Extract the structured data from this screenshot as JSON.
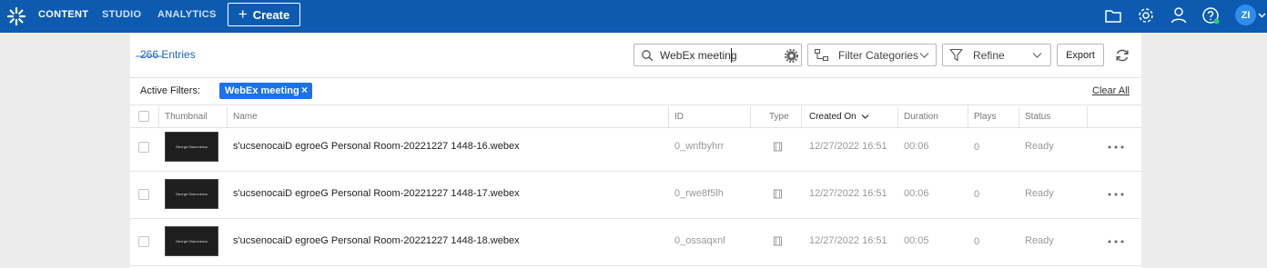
{
  "nav": {
    "items": [
      "CONTENT",
      "STUDIO",
      "ANALYTICS"
    ],
    "create_label": "Create",
    "avatar_initials": "ZI"
  },
  "toolbar": {
    "entries_count": "266 Entries",
    "search_value": "WebEx meeting",
    "filter_categories_label": "Filter Categories",
    "refine_label": "Refine",
    "export_label": "Export"
  },
  "filters": {
    "active_label": "Active Filters:",
    "chips": [
      "WebEx meeting"
    ],
    "clear_all_label": "Clear All"
  },
  "table": {
    "headers": {
      "thumbnail": "Thumbnail",
      "name": "Name",
      "id": "ID",
      "type": "Type",
      "created_on": "Created On",
      "duration": "Duration",
      "plays": "Plays",
      "status": "Status"
    },
    "rows": [
      {
        "thumb_text": "George Diaconescu",
        "name": "George Diaconescu's Personal Room-20221227 1448-16.webex",
        "name_display": "s'ucsenocaiD egroeG Personal Room-20221227 1448-16.webex",
        "id": "0_wnfbyhrr",
        "created_on": "12/27/2022 16:51",
        "duration": "00:06",
        "plays": "0",
        "status": "Ready"
      },
      {
        "thumb_text": "George Diaconescu",
        "name": "George Diaconescu's Personal Room-20221227 1448-17.webex",
        "name_display": "s'ucsenocaiD egroeG Personal Room-20221227 1448-17.webex",
        "id": "0_rwe8f5lh",
        "created_on": "12/27/2022 16:51",
        "duration": "00:06",
        "plays": "0",
        "status": "Ready"
      },
      {
        "thumb_text": "George Diaconescu",
        "name": "George Diaconescu's Personal Room-20221227 1448-18.webex",
        "name_display": "s'ucsenocaiD egroeG Personal Room-20221227 1448-18.webex",
        "id": "0_ossaqxnl",
        "created_on": "12/27/2022 16:51",
        "duration": "00:05",
        "plays": "0",
        "status": "Ready"
      }
    ]
  },
  "colors": {
    "topbar": "#0c5bb0",
    "accent": "#1a73e8",
    "page_bg": "#ececec"
  }
}
